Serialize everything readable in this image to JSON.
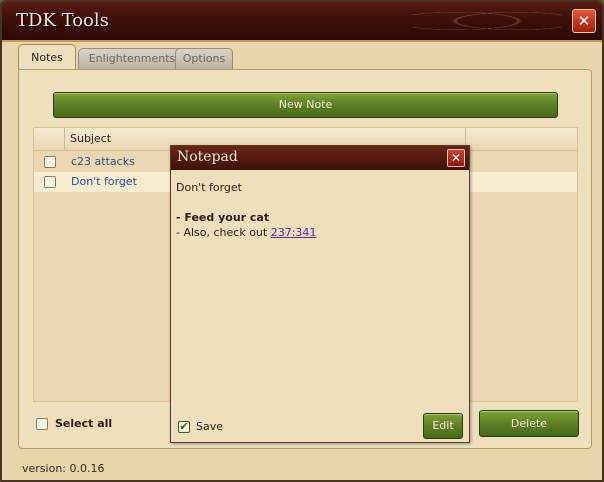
{
  "window": {
    "title": "TDK Tools",
    "close_glyph": "✕",
    "version_text": "version: 0.0.16"
  },
  "tabs": [
    {
      "label": "Notes",
      "active": true
    },
    {
      "label": "Enlightenments",
      "active": false
    },
    {
      "label": "Options",
      "active": false
    }
  ],
  "notes": {
    "new_note_label": "New Note",
    "column_subject": "Subject",
    "rows": [
      {
        "subject": "c23 attacks",
        "checked": false
      },
      {
        "subject": "Don't forget",
        "checked": false
      }
    ],
    "select_all_label": "Select all",
    "delete_label": "Delete"
  },
  "notepad": {
    "title": "Notepad",
    "close_glyph": "✕",
    "line1": "Don't forget",
    "bold_line": "- Feed your cat",
    "line3_prefix": "- Also, check out ",
    "line3_link": "237:341",
    "save_label": "Save",
    "save_checked": true,
    "save_check_glyph": "✔",
    "edit_label": "Edit"
  },
  "icons": {
    "close": "close-icon",
    "checkmark": "check-icon"
  },
  "colors": {
    "accent_green": "#5c7f24",
    "title_bar": "#3e0f0a",
    "close_red": "#c24631",
    "link_blue": "#2d4f8f",
    "link_purple": "#5b2aa0"
  }
}
